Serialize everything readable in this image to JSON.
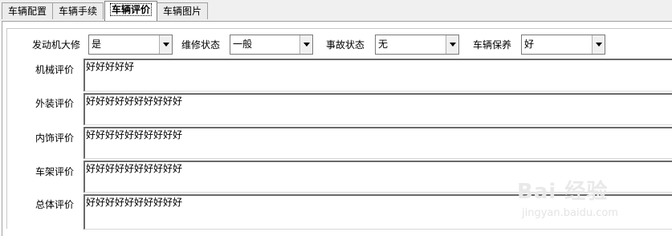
{
  "tabs": [
    {
      "label": "车辆配置",
      "active": false
    },
    {
      "label": "车辆手续",
      "active": false
    },
    {
      "label": "车辆评价",
      "active": true
    },
    {
      "label": "车辆图片",
      "active": false
    }
  ],
  "fields": {
    "engine_overhaul": {
      "label": "发动机大修",
      "value": "是"
    },
    "repair_status": {
      "label": "维修状态",
      "value": "一般"
    },
    "accident_status": {
      "label": "事故状态",
      "value": "无"
    },
    "maintenance": {
      "label": "车辆保养",
      "value": "好"
    }
  },
  "evaluations": [
    {
      "label": "机械评价",
      "value": "好好好好好"
    },
    {
      "label": "外装评价",
      "value": "好好好好好好好好好好"
    },
    {
      "label": "内饰评价",
      "value": "好好好好好好好好好好"
    },
    {
      "label": "车架评价",
      "value": "好好好好好好好好好好"
    },
    {
      "label": "总体评价",
      "value": "好好好好好好好好好好"
    }
  ],
  "watermark": {
    "brand": "Bai 经验",
    "url": "jingyan.baidu.com"
  }
}
